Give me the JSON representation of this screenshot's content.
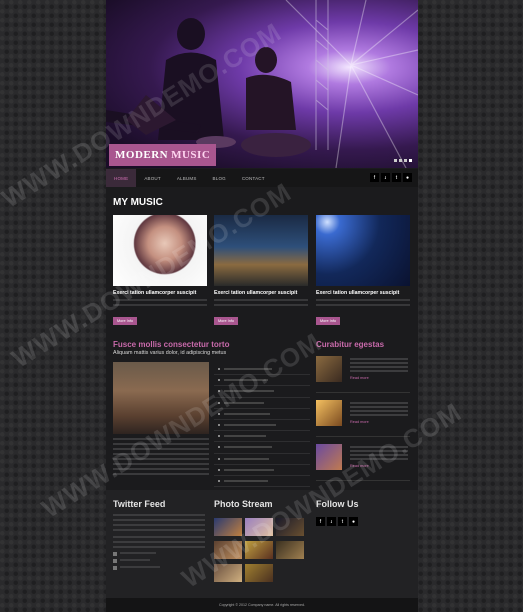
{
  "logo": {
    "word1": "MODERN",
    "word2": "MUSIC"
  },
  "nav": {
    "items": [
      "Home",
      "About",
      "Albums",
      "Blog",
      "Contact"
    ]
  },
  "social_icons": [
    "facebook-icon",
    "rss-icon",
    "twitter-icon",
    "flickr-icon"
  ],
  "my_music": {
    "heading": "MY MUSIC",
    "cards": [
      {
        "title": "Exerci tation ullamcorper suscipit",
        "button": "More Info"
      },
      {
        "title": "Exerci tation ullamcorper suscipit",
        "button": "More Info"
      },
      {
        "title": "Exerci tation ullamcorper suscipit",
        "button": "More Info"
      }
    ]
  },
  "feature": {
    "title": "Fusce mollis consectetur torto",
    "subtitle": "Aliquam mattis varius dolor, id adipiscing metus"
  },
  "curabitur": {
    "heading": "Curabitur egestas",
    "more_label": "Read more"
  },
  "footer": {
    "twitter_heading": "Twitter Feed",
    "photo_heading": "Photo Stream",
    "follow_heading": "Follow Us",
    "copyright": "Copyright © 2012 Company name. All rights reserved."
  },
  "watermark": "WWW.DOWNDEMO.COM",
  "colors": {
    "accent": "#a9568f",
    "accent_text": "#c96aab"
  }
}
